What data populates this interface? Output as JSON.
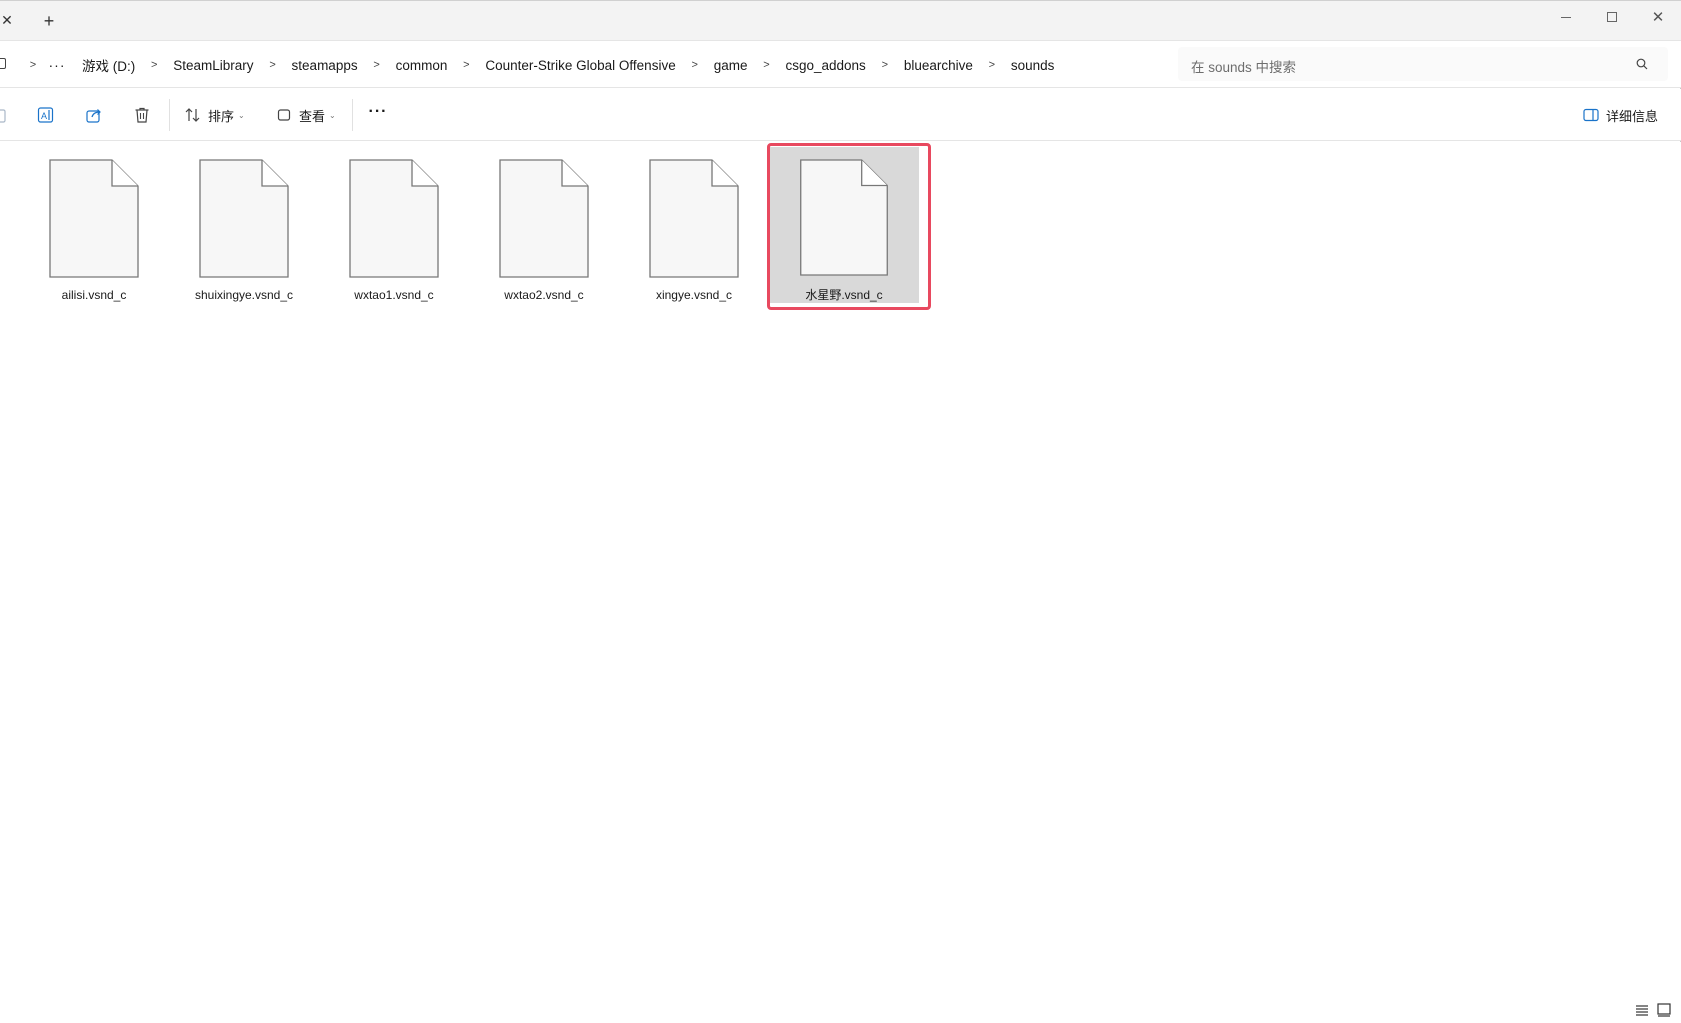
{
  "tabbar": {
    "close_icon": "close-icon",
    "new_tab_icon": "plus-icon"
  },
  "window_controls": [
    "minimize-icon",
    "maximize-icon",
    "close-icon"
  ],
  "address": {
    "ellipsis": "···",
    "crumbs": [
      "游戏 (D:)",
      "SteamLibrary",
      "steamapps",
      "common",
      "Counter-Strike Global Offensive",
      "game",
      "csgo_addons",
      "bluearchive",
      "sounds"
    ],
    "search_placeholder": "在 sounds 中搜索"
  },
  "commands": {
    "sort_label": "排序",
    "view_label": "查看",
    "more_label": "···",
    "details_label": "详细信息"
  },
  "files": [
    {
      "name": "ailisi.vsnd_c",
      "selected": false
    },
    {
      "name": "shuixingye.vsnd_c",
      "selected": false
    },
    {
      "name": "wxtao1.vsnd_c",
      "selected": false
    },
    {
      "name": "wxtao2.vsnd_c",
      "selected": false
    },
    {
      "name": "xingye.vsnd_c",
      "selected": false
    },
    {
      "name": "水星野.vsnd_c",
      "selected": true
    }
  ],
  "colors": {
    "highlight_frame": "#e8495f",
    "selected_bg": "#d9d9d9",
    "accent_icon": "#1a73c9"
  }
}
